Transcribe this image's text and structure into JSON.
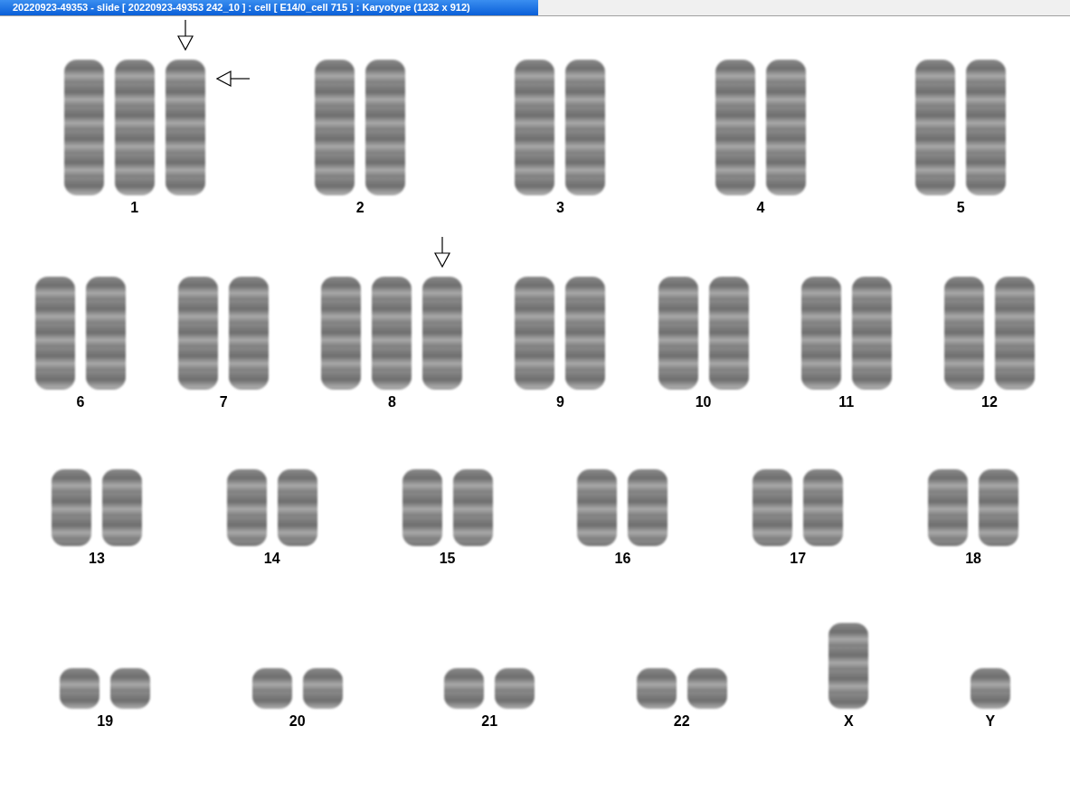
{
  "window": {
    "title": "20220923-49353 - slide [ 20220923-49353 242_10 ] : cell [ E14/0_cell 715 ] : Karyotype  (1232 x 912)"
  },
  "rows": [
    {
      "groups": [
        {
          "label": "1",
          "chromosomes": [
            {
              "kind": "chromosome"
            },
            {
              "kind": "chromosome"
            },
            {
              "kind": "chromosome",
              "arrows": [
                {
                  "kind": "down"
                },
                {
                  "kind": "left"
                }
              ]
            }
          ]
        },
        {
          "label": "2",
          "chromosomes": [
            {
              "kind": "chromosome"
            },
            {
              "kind": "chromosome"
            }
          ]
        },
        {
          "label": "3",
          "chromosomes": [
            {
              "kind": "chromosome"
            },
            {
              "kind": "chromosome"
            }
          ]
        },
        {
          "label": "4",
          "chromosomes": [
            {
              "kind": "chromosome"
            },
            {
              "kind": "chromosome"
            }
          ]
        },
        {
          "label": "5",
          "chromosomes": [
            {
              "kind": "chromosome"
            },
            {
              "kind": "chromosome"
            }
          ]
        }
      ]
    },
    {
      "groups": [
        {
          "label": "6",
          "chromosomes": [
            {
              "kind": "chromosome"
            },
            {
              "kind": "chromosome"
            }
          ]
        },
        {
          "label": "7",
          "chromosomes": [
            {
              "kind": "chromosome"
            },
            {
              "kind": "chromosome"
            }
          ]
        },
        {
          "label": "8",
          "chromosomes": [
            {
              "kind": "chromosome"
            },
            {
              "kind": "chromosome"
            },
            {
              "kind": "chromosome",
              "arrows": [
                {
                  "kind": "down"
                }
              ]
            }
          ]
        },
        {
          "label": "9",
          "chromosomes": [
            {
              "kind": "chromosome"
            },
            {
              "kind": "chromosome"
            }
          ]
        },
        {
          "label": "10",
          "chromosomes": [
            {
              "kind": "chromosome"
            },
            {
              "kind": "chromosome"
            }
          ]
        },
        {
          "label": "11",
          "chromosomes": [
            {
              "kind": "chromosome"
            },
            {
              "kind": "chromosome"
            }
          ]
        },
        {
          "label": "12",
          "chromosomes": [
            {
              "kind": "chromosome"
            },
            {
              "kind": "chromosome"
            }
          ]
        }
      ]
    },
    {
      "groups": [
        {
          "label": "13",
          "chromosomes": [
            {
              "kind": "chromosome"
            },
            {
              "kind": "chromosome"
            }
          ]
        },
        {
          "label": "14",
          "chromosomes": [
            {
              "kind": "chromosome"
            },
            {
              "kind": "chromosome"
            }
          ]
        },
        {
          "label": "15",
          "chromosomes": [
            {
              "kind": "chromosome"
            },
            {
              "kind": "chromosome"
            }
          ]
        },
        {
          "label": "16",
          "chromosomes": [
            {
              "kind": "chromosome"
            },
            {
              "kind": "chromosome"
            }
          ]
        },
        {
          "label": "17",
          "chromosomes": [
            {
              "kind": "chromosome"
            },
            {
              "kind": "chromosome"
            }
          ]
        },
        {
          "label": "18",
          "chromosomes": [
            {
              "kind": "chromosome"
            },
            {
              "kind": "chromosome"
            }
          ]
        }
      ]
    },
    {
      "groups": [
        {
          "label": "19",
          "chromosomes": [
            {
              "kind": "chromosome"
            },
            {
              "kind": "chromosome"
            }
          ]
        },
        {
          "label": "20",
          "chromosomes": [
            {
              "kind": "chromosome"
            },
            {
              "kind": "chromosome"
            }
          ]
        },
        {
          "label": "21",
          "chromosomes": [
            {
              "kind": "chromosome"
            },
            {
              "kind": "chromosome"
            }
          ]
        },
        {
          "label": "22",
          "chromosomes": [
            {
              "kind": "chromosome"
            },
            {
              "kind": "chromosome"
            }
          ]
        },
        {
          "label": "X",
          "chromosomes": [
            {
              "kind": "chromosome"
            }
          ]
        },
        {
          "label": "Y",
          "chromosomes": [
            {
              "kind": "chromosome"
            }
          ]
        }
      ]
    }
  ]
}
